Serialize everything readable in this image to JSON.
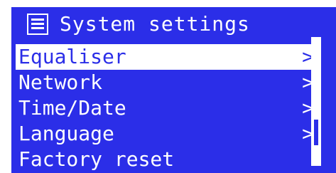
{
  "header": {
    "icon": "menu-list-icon",
    "title": "System settings"
  },
  "menu": {
    "items": [
      {
        "label": "Equaliser",
        "arrow": ">",
        "selected": true
      },
      {
        "label": "Network",
        "arrow": ">",
        "selected": false
      },
      {
        "label": "Time/Date",
        "arrow": ">",
        "selected": false
      },
      {
        "label": "Language",
        "arrow": ">",
        "selected": false
      },
      {
        "label": "Factory reset",
        "arrow": "",
        "selected": false
      }
    ]
  },
  "scrollbar": {
    "position_fraction": 0.8
  },
  "colors": {
    "background": "#2b2ee8",
    "foreground": "#ffffff",
    "selection_bg": "#ffffff",
    "selection_fg": "#2b2ee8"
  }
}
